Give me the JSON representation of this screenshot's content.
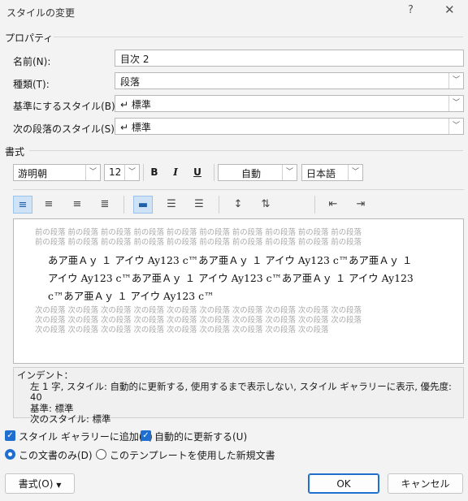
{
  "window": {
    "title": "スタイルの変更",
    "help": "?",
    "close": "✕"
  },
  "properties": {
    "section": "プロパティ",
    "name_label": "名前(N):",
    "name_value": "目次 2",
    "type_label": "種類(T):",
    "type_value": "段落",
    "based_label": "基準にするスタイル(B):",
    "based_value": "↵ 標準",
    "next_label": "次の段落のスタイル(S):",
    "next_value": "↵ 標準"
  },
  "format": {
    "section": "書式",
    "font": "游明朝",
    "size": "12",
    "bold": "B",
    "italic": "I",
    "underline": "U",
    "color": "自動",
    "language": "日本語"
  },
  "preview": {
    "prev_line1": "前の段落 前の段落 前の段落 前の段落 前の段落 前の段落 前の段落 前の段落 前の段落 前の段落",
    "prev_line2": "前の段落 前の段落 前の段落 前の段落 前の段落 前の段落 前の段落 前の段落 前の段落 前の段落",
    "main_line1": "あア亜Ａｙ １ アイウ Ay123 c™あア亜Ａｙ １ アイウ Ay123 c™あア亜Ａｙ １",
    "main_line2": "アイウ Ay123 c™あア亜Ａｙ １ アイウ Ay123 c™あア亜Ａｙ １ アイウ Ay123",
    "main_line3": "c™あア亜Ａｙ １ アイウ Ay123 c™",
    "next_line1": "次の段落 次の段落 次の段落 次の段落 次の段落 次の段落 次の段落 次の段落 次の段落 次の段落",
    "next_line2": "次の段落 次の段落 次の段落 次の段落 次の段落 次の段落 次の段落 次の段落 次の段落 次の段落",
    "next_line3": "次の段落 次の段落 次の段落 次の段落 次の段落 次の段落 次の段落 次の段落 次の段落"
  },
  "description": {
    "line1": "インデント：",
    "line2": "左  1 字, スタイル: 自動的に更新する, 使用するまで表示しない, スタイル ギャラリーに表示, 優先度: 40",
    "line3": "基準: 標準",
    "line4": "次のスタイル: 標準"
  },
  "options": {
    "add_gallery": "スタイル ギャラリーに追加(S)",
    "auto_update": "自動的に更新する(U)",
    "this_doc": "この文書のみ(D)",
    "new_docs": "このテンプレートを使用した新規文書"
  },
  "buttons": {
    "format": "書式(O)",
    "ok": "OK",
    "cancel": "キャンセル"
  },
  "colors": {
    "accent": "#1e6fd0",
    "background": "#f3f3f3"
  }
}
